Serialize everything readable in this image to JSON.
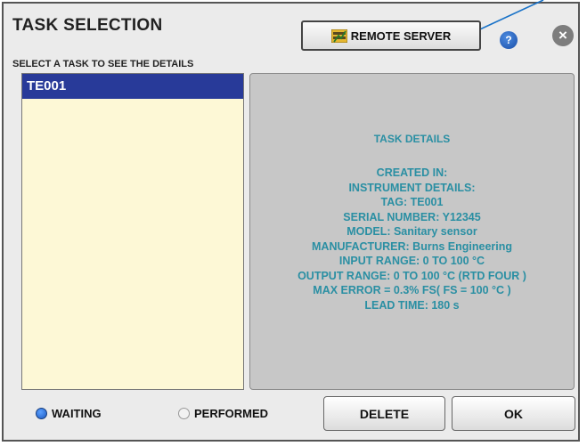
{
  "header": {
    "title": "TASK SELECTION",
    "remote_server_label": "REMOTE SERVER",
    "help_label": "?",
    "close_label": "×"
  },
  "list_caption": "SELECT A TASK TO SEE THE DETAILS",
  "tasks": [
    {
      "id": "TE001",
      "selected": true
    }
  ],
  "details": {
    "heading": "TASK DETAILS",
    "lines": [
      "CREATED IN:",
      "INSTRUMENT DETAILS:",
      "TAG: TE001",
      "SERIAL NUMBER: Y12345",
      "MODEL: Sanitary sensor",
      "MANUFACTURER: Burns Engineering",
      "INPUT RANGE: 0 TO 100 °C",
      "OUTPUT RANGE: 0 TO 100 °C (RTD FOUR )",
      "MAX ERROR = 0.3% FS( FS = 100 °C )",
      "LEAD TIME: 180 s"
    ]
  },
  "filters": {
    "waiting_label": "WAITING",
    "waiting_selected": true,
    "performed_label": "PERFORMED",
    "performed_selected": false
  },
  "actions": {
    "delete_label": "DELETE",
    "ok_label": "OK"
  },
  "colors": {
    "selection": "#283a99",
    "details_text": "#2a8fa3",
    "list_background": "#fdf8d6",
    "annotation_arrow": "#1a73c8"
  }
}
